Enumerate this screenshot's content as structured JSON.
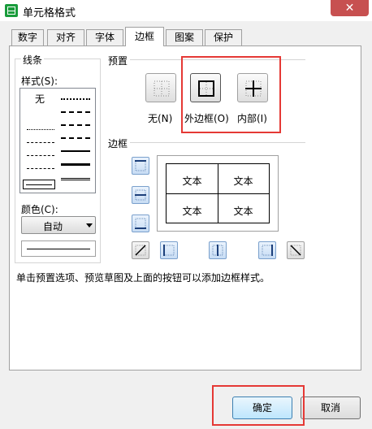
{
  "window": {
    "title": "单元格格式",
    "close_label": "✕"
  },
  "tabs": [
    {
      "label": "数字",
      "active": false
    },
    {
      "label": "对齐",
      "active": false
    },
    {
      "label": "字体",
      "active": false
    },
    {
      "label": "边框",
      "active": true
    },
    {
      "label": "图案",
      "active": false
    },
    {
      "label": "保护",
      "active": false
    }
  ],
  "line_group": {
    "title": "线条",
    "style_label": "样式(S):",
    "style_hotkey": "S",
    "none_label": "无",
    "color_label": "颜色(C):",
    "color_hotkey": "C",
    "color_value": "自动"
  },
  "presets": {
    "title": "预置",
    "none": {
      "label": "无(N)",
      "hotkey": "N"
    },
    "outline": {
      "label": "外边框(O)",
      "hotkey": "O"
    },
    "inside": {
      "label": "内部(I)",
      "hotkey": "I"
    }
  },
  "border_group": {
    "title": "边框",
    "preview_cells": [
      "文本",
      "文本",
      "文本",
      "文本"
    ]
  },
  "info_text": "单击预置选项、预览草图及上面的按钮可以添加边框样式。",
  "buttons": {
    "ok": "确定",
    "cancel": "取消"
  },
  "colors": {
    "highlight": "#e53935",
    "app_icon": "#1a9c3c",
    "close": "#c75050"
  }
}
